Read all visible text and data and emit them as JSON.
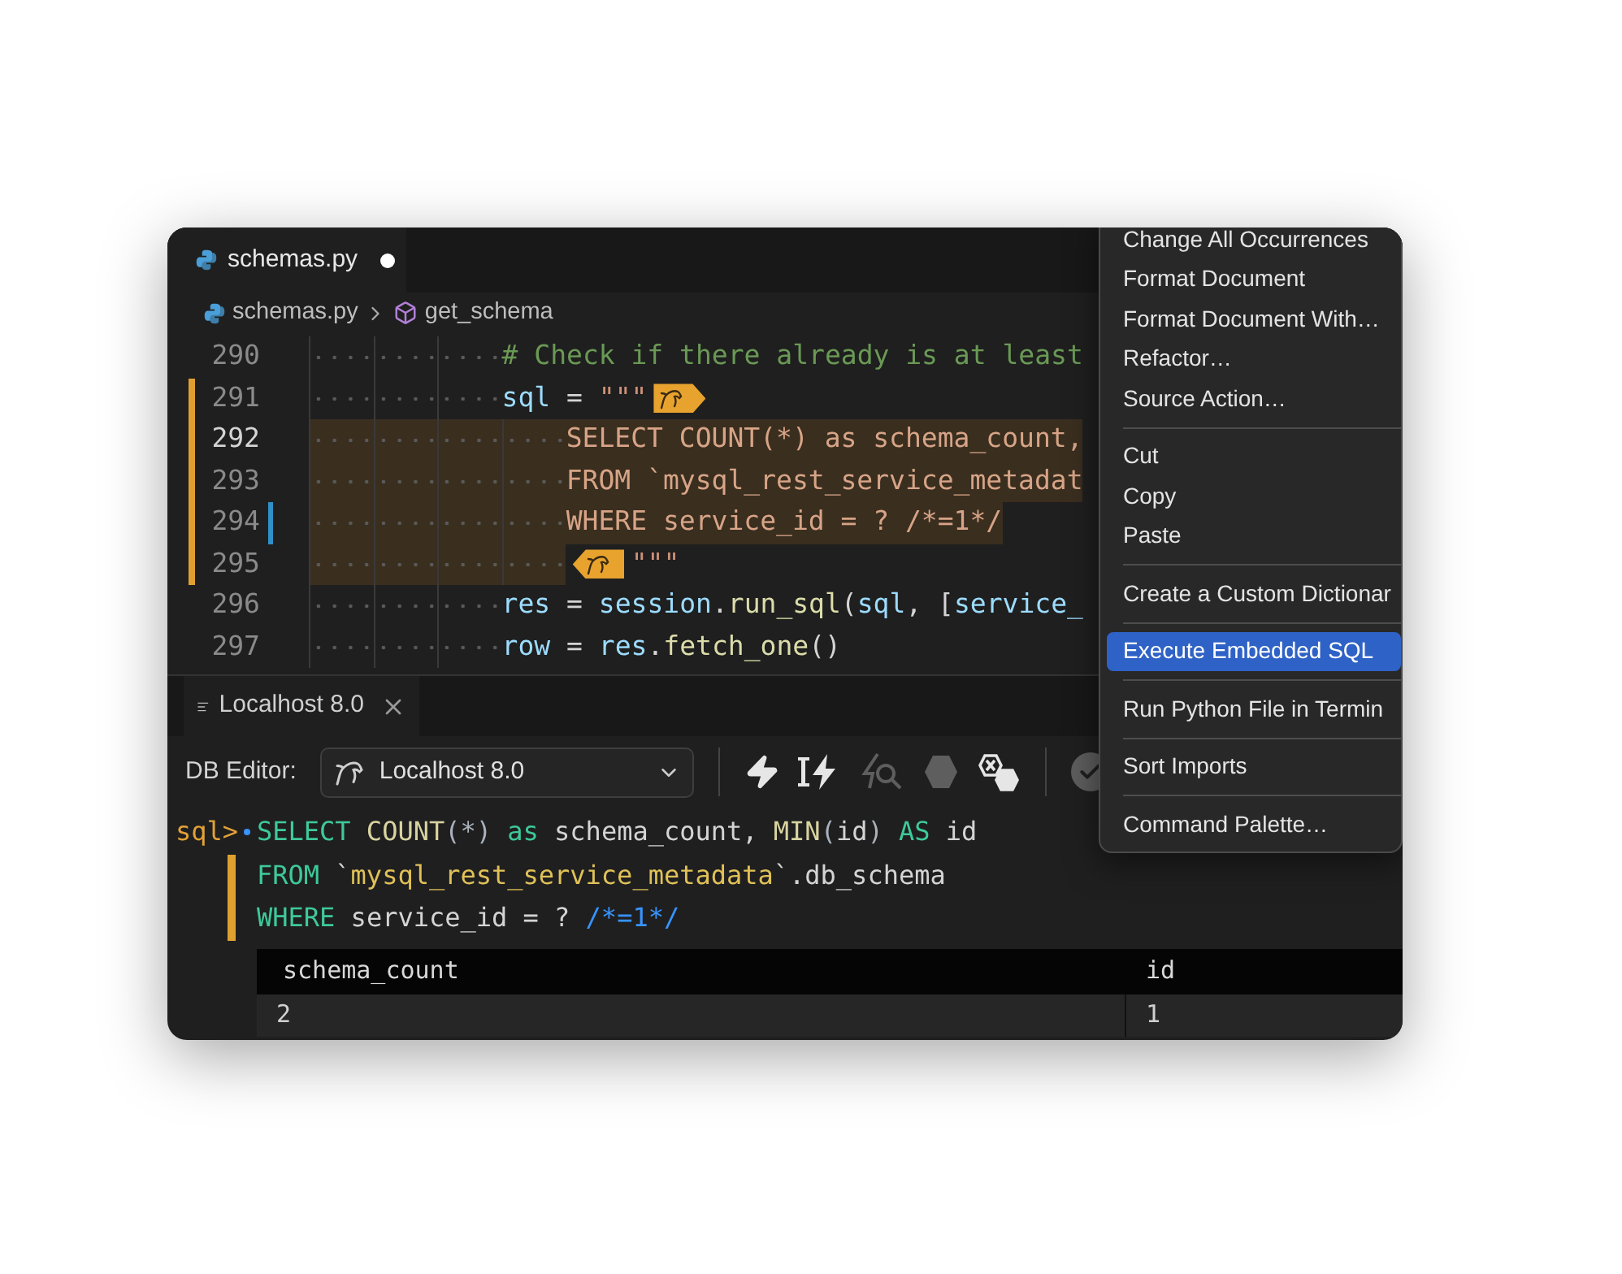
{
  "editor": {
    "tab": {
      "label": "schemas.py",
      "modified": true
    },
    "breadcrumb": [
      {
        "label": "schemas.py",
        "kind": "file"
      },
      {
        "label": "get_schema",
        "kind": "symbol"
      }
    ],
    "lines": [
      {
        "number": "290",
        "current": false,
        "sql_block": false,
        "modified": false,
        "kind": "body",
        "tokens": [
          {
            "kind": "comment",
            "text": "# Check if there already is at least"
          }
        ]
      },
      {
        "number": "291",
        "current": false,
        "sql_block": true,
        "modified": false,
        "kind": "body",
        "tokens": [
          {
            "kind": "var",
            "text": "sql"
          },
          {
            "kind": "op",
            "text": " = "
          },
          {
            "kind": "str",
            "text": "\"\"\""
          },
          {
            "kind": "open_tag"
          }
        ]
      },
      {
        "number": "292",
        "current": true,
        "sql_block": true,
        "modified": false,
        "kind": "sql",
        "tokens": [
          {
            "kind": "sql",
            "text": "SELECT COUNT(*) as schema_count,"
          }
        ]
      },
      {
        "number": "293",
        "current": false,
        "sql_block": true,
        "modified": false,
        "kind": "sql",
        "tokens": [
          {
            "kind": "sql",
            "text": "FROM `mysql_rest_service_metadat"
          }
        ]
      },
      {
        "number": "294",
        "current": false,
        "sql_block": true,
        "modified": true,
        "kind": "sql",
        "tokens": [
          {
            "kind": "sql",
            "text": "WHERE service_id = ? /*=1*/"
          }
        ]
      },
      {
        "number": "295",
        "current": false,
        "sql_block": true,
        "modified": false,
        "kind": "sql",
        "tokens": [
          {
            "kind": "close_tag"
          },
          {
            "kind": "str",
            "text": "\"\"\""
          }
        ]
      },
      {
        "number": "296",
        "current": false,
        "sql_block": false,
        "modified": false,
        "kind": "body",
        "tokens": [
          {
            "kind": "var",
            "text": "res"
          },
          {
            "kind": "op",
            "text": " = "
          },
          {
            "kind": "var",
            "text": "session"
          },
          {
            "kind": "op",
            "text": "."
          },
          {
            "kind": "func",
            "text": "run_sql"
          },
          {
            "kind": "op",
            "text": "("
          },
          {
            "kind": "var",
            "text": "sql"
          },
          {
            "kind": "op",
            "text": ", ["
          },
          {
            "kind": "var",
            "text": "service_"
          }
        ]
      },
      {
        "number": "297",
        "current": false,
        "sql_block": false,
        "modified": false,
        "kind": "body",
        "tokens": [
          {
            "kind": "var",
            "text": "row"
          },
          {
            "kind": "op",
            "text": " = "
          },
          {
            "kind": "var",
            "text": "res"
          },
          {
            "kind": "op",
            "text": "."
          },
          {
            "kind": "func",
            "text": "fetch_one"
          },
          {
            "kind": "op",
            "text": "()"
          }
        ]
      }
    ]
  },
  "context_menu": {
    "groups": [
      [
        {
          "label": "Change All Occurrences",
          "selected": false
        },
        {
          "label": "Format Document",
          "selected": false
        },
        {
          "label": "Format Document With…",
          "selected": false
        },
        {
          "label": "Refactor…",
          "selected": false
        },
        {
          "label": "Source Action…",
          "selected": false
        }
      ],
      [
        {
          "label": "Cut",
          "selected": false
        },
        {
          "label": "Copy",
          "selected": false
        },
        {
          "label": "Paste",
          "selected": false
        }
      ],
      [
        {
          "label": "Create a Custom Dictionar",
          "selected": false
        }
      ],
      [
        {
          "label": "Execute Embedded SQL",
          "selected": true
        }
      ],
      [
        {
          "label": "Run Python File in Termin",
          "selected": false
        }
      ],
      [
        {
          "label": "Sort Imports",
          "selected": false
        }
      ],
      [
        {
          "label": "Command Palette…",
          "selected": false
        }
      ]
    ]
  },
  "panel": {
    "tab": {
      "label": "Localhost 8.0"
    },
    "toolbar": {
      "label": "DB Editor:",
      "connection": "Localhost 8.0",
      "buttons": [
        {
          "kind": "execute",
          "disabled": false
        },
        {
          "kind": "execute_cursor",
          "disabled": false
        },
        {
          "kind": "explain",
          "disabled": true
        },
        {
          "kind": "stop",
          "disabled": true
        },
        {
          "kind": "stop_on_error",
          "disabled": false
        },
        {
          "kind": "commit",
          "disabled": true
        }
      ]
    },
    "console": {
      "prompt": "sql>",
      "lines": [
        {
          "sql_block": false,
          "tokens": [
            {
              "kind": "keyword",
              "text": "SELECT"
            },
            {
              "kind": "func",
              "text": " COUNT"
            },
            {
              "kind": "punct",
              "text": "(*)"
            },
            {
              "kind": "keyword",
              "text": " as"
            },
            {
              "kind": "plain",
              "text": " schema_count, "
            },
            {
              "kind": "func",
              "text": "MIN"
            },
            {
              "kind": "punct",
              "text": "("
            },
            {
              "kind": "plain",
              "text": "id"
            },
            {
              "kind": "punct",
              "text": ")"
            },
            {
              "kind": "keyword",
              "text": " AS"
            },
            {
              "kind": "plain",
              "text": " id"
            }
          ]
        },
        {
          "sql_block": true,
          "tokens": [
            {
              "kind": "keyword",
              "text": "FROM"
            },
            {
              "kind": "plain",
              "text": " `"
            },
            {
              "kind": "string",
              "text": "mysql_rest_service_metadata"
            },
            {
              "kind": "plain",
              "text": "`.db_schema"
            }
          ]
        },
        {
          "sql_block": true,
          "tokens": [
            {
              "kind": "keyword",
              "text": "WHERE"
            },
            {
              "kind": "plain",
              "text": " service_id = ? "
            },
            {
              "kind": "comment",
              "text": "/*=1*/"
            }
          ]
        }
      ]
    },
    "result": {
      "columns": [
        "schema_count",
        "id"
      ],
      "rows": [
        [
          "2",
          "1"
        ]
      ]
    }
  }
}
